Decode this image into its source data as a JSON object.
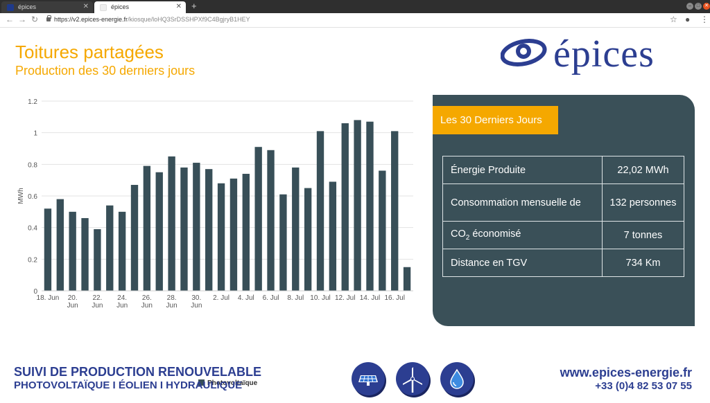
{
  "browser": {
    "tabs": [
      {
        "label": "épices",
        "active": false
      },
      {
        "label": "épices",
        "active": true
      }
    ],
    "url_domain": "https://v2.epices-energie.fr",
    "url_path": "/kiosque/loHQ3SrDSSHPXf9C4BgjryB1HEY"
  },
  "header": {
    "title": "Toitures partagées",
    "subtitle": "Production des 30 derniers jours",
    "logo_text": "épices"
  },
  "colors": {
    "accent": "#f5a800",
    "brand": "#2c3e91",
    "bar": "#384f58",
    "panel": "#3a5058"
  },
  "chart_data": {
    "type": "bar",
    "ylabel": "MWh",
    "ylim": [
      0,
      1.2
    ],
    "yticks": [
      "0",
      "0.2",
      "0.4",
      "0.6",
      "0.8",
      "1",
      "1.2"
    ],
    "grid": true,
    "legend_position": "bottom-center",
    "tick_labels": [
      {
        "i": 0,
        "lines": [
          "18. Jun"
        ]
      },
      {
        "i": 2,
        "lines": [
          "20.",
          "Jun"
        ]
      },
      {
        "i": 4,
        "lines": [
          "22.",
          "Jun"
        ]
      },
      {
        "i": 6,
        "lines": [
          "24.",
          "Jun"
        ]
      },
      {
        "i": 8,
        "lines": [
          "26.",
          "Jun"
        ]
      },
      {
        "i": 10,
        "lines": [
          "28.",
          "Jun"
        ]
      },
      {
        "i": 12,
        "lines": [
          "30.",
          "Jun"
        ]
      },
      {
        "i": 14,
        "lines": [
          "2. Jul"
        ]
      },
      {
        "i": 16,
        "lines": [
          "4. Jul"
        ]
      },
      {
        "i": 18,
        "lines": [
          "6. Jul"
        ]
      },
      {
        "i": 20,
        "lines": [
          "8. Jul"
        ]
      },
      {
        "i": 22,
        "lines": [
          "10. Jul"
        ]
      },
      {
        "i": 24,
        "lines": [
          "12. Jul"
        ]
      },
      {
        "i": 26,
        "lines": [
          "14. Jul"
        ]
      },
      {
        "i": 28,
        "lines": [
          "16. Jul"
        ]
      }
    ],
    "series": [
      {
        "name": "Photovoltaïque",
        "values": [
          0.52,
          0.58,
          0.5,
          0.46,
          0.39,
          0.54,
          0.5,
          0.67,
          0.79,
          0.75,
          0.85,
          0.78,
          0.81,
          0.77,
          0.68,
          0.71,
          0.74,
          0.91,
          0.89,
          0.61,
          0.78,
          0.65,
          1.01,
          0.69,
          1.06,
          1.08,
          1.07,
          0.76,
          1.01,
          0.15
        ]
      }
    ]
  },
  "panel": {
    "badge": "Les 30 Derniers Jours",
    "rows": [
      {
        "label": "Énergie Produite",
        "value": "22,02 MWh"
      },
      {
        "label": "Consommation mensuelle de",
        "value": "132 personnes"
      },
      {
        "label_prefix": "CO",
        "label_sub": "2",
        "label_suffix": " économisé",
        "value": "7 tonnes"
      },
      {
        "label": "Distance en TGV",
        "value": "734 Km"
      }
    ]
  },
  "footer": {
    "line1": "SUIVI DE PRODUCTION RENOUVELABLE",
    "line2": "PHOTOVOLTAÏQUE I ÉOLIEN I HYDRAULIQUE",
    "icons": [
      "solar-panel-icon",
      "wind-turbine-icon",
      "water-drop-icon"
    ],
    "website": "www.epices-energie.fr",
    "phone": "+33 (0)4 82 53 07 55"
  }
}
